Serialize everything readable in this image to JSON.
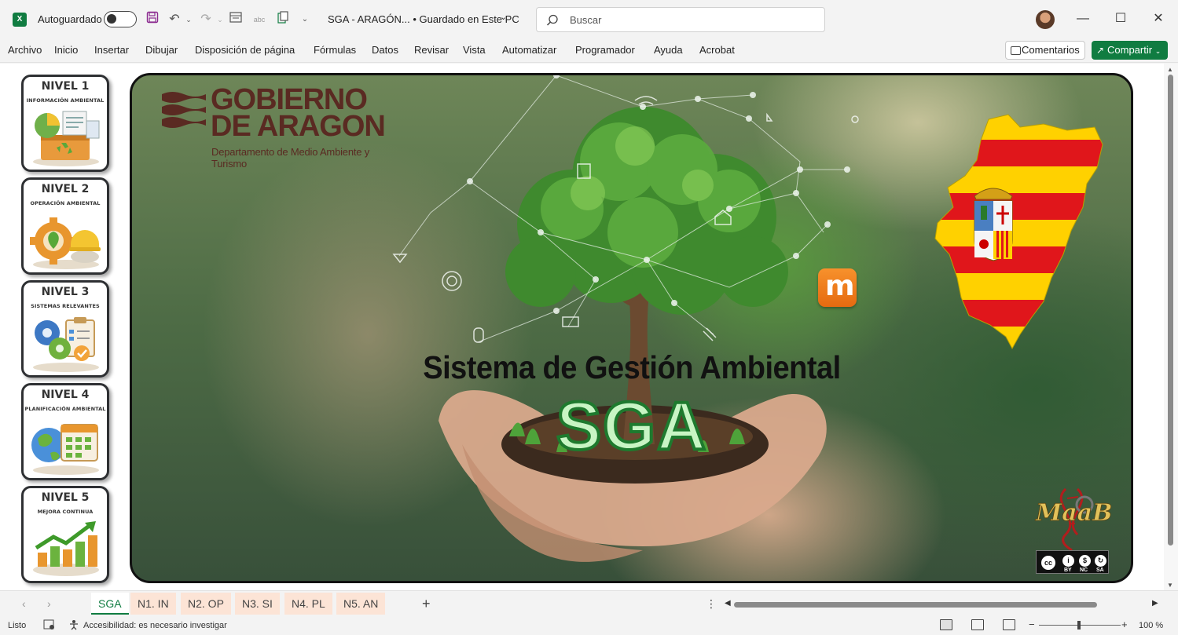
{
  "app": {
    "autosave_label": "Autoguardado",
    "doc_title": "SGA - ARAGÓN... • Guardado en Este PC",
    "search_placeholder": "Buscar"
  },
  "ribbon": {
    "tabs": [
      "Archivo",
      "Inicio",
      "Insertar",
      "Dibujar",
      "Disposición de página",
      "Fórmulas",
      "Datos",
      "Revisar",
      "Vista",
      "Automatizar",
      "Programador",
      "Ayuda",
      "Acrobat"
    ],
    "comments_label": "Comentarios",
    "share_label": "Compartir"
  },
  "levels": [
    {
      "title": "NIVEL 1",
      "subtitle": "INFORMACIÓN AMBIENTAL",
      "icon": "recycling-info-icon"
    },
    {
      "title": "NIVEL 2",
      "subtitle": "OPERACIÓN AMBIENTAL",
      "icon": "gear-plant-helmet-icon"
    },
    {
      "title": "NIVEL 3",
      "subtitle": "SISTEMAS RELEVANTES",
      "icon": "gears-checklist-icon"
    },
    {
      "title": "NIVEL 4",
      "subtitle": "PLANIFICACIÓN AMBIENTAL",
      "icon": "globe-calendar-icon"
    },
    {
      "title": "NIVEL 5",
      "subtitle": "MEJORA CONTINUA",
      "icon": "growth-chart-icon"
    }
  ],
  "banner": {
    "gov_name_line1": "GOBIERNO",
    "gov_name_line2": "DE ARAGON",
    "gov_dept": "Departamento de Medio Ambiente y Turismo",
    "subtitle": "Sistema de Gestión Ambiental",
    "title": "SGA",
    "author_logo": "MaaB",
    "license": [
      "BY",
      "NC",
      "SA"
    ]
  },
  "sheet_tabs": [
    "SGA",
    "N1. IN",
    "N2. OP",
    "N3. SI",
    "N4. PL",
    "N5. AN"
  ],
  "active_sheet": "SGA",
  "status": {
    "ready": "Listo",
    "accessibility": "Accesibilidad: es necesario investigar",
    "zoom": "100 %"
  },
  "colors": {
    "excel_green": "#107c41",
    "gov_brown": "#5a2a22",
    "sga_fill": "#c8f5c4",
    "sga_stroke": "#1e7a2e",
    "aragon_red": "#e0161b",
    "aragon_yellow": "#ffd100",
    "peach_tab": "#fce4d6"
  }
}
